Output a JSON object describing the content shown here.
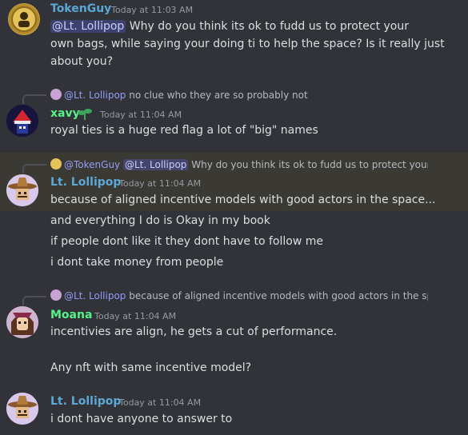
{
  "messages": [
    {
      "author": "TokenGuy",
      "timestamp": "Today at 11:03 AM",
      "mention": "@Lt. Lollipop",
      "line1": " Why do you think its ok to fudd us to protect your",
      "line2": "own bags, while saying your doing ti to help the space? Is it really just",
      "line3": "about you?"
    },
    {
      "reply_name": "@Lt. Lollipop",
      "reply_text": " no clue who they are so probably not",
      "author": "xavy",
      "timestamp": "Today at 11:04 AM",
      "line1": "royal ties is a huge red flag a lot of \"big\" names"
    },
    {
      "reply_name": "@TokenGuy",
      "reply_mention": "@Lt. Lollipop",
      "reply_text": " Why do you think its ok to fudd us to protect your",
      "author": "Lt. Lollipop",
      "timestamp": "Today at 11:04 AM",
      "line1": "because of aligned incentive models with good actors in the space...",
      "line2": "and everything I do is Okay in my book",
      "line3": "if people dont like it they dont have to follow me",
      "line4": "i dont take money from people"
    },
    {
      "reply_name": "@Lt. Lollipop",
      "reply_text": " because of aligned incentive models with good actors in the sp",
      "author": "Moana",
      "timestamp": "Today at 11:04 AM",
      "line1": "incentivies are align, he gets a cut of performance.",
      "line2": "Any nft with same incentive model?"
    },
    {
      "author": "Lt. Lollipop",
      "timestamp": "Today at 11:04 AM",
      "line1": "i dont have anyone to answer to"
    }
  ],
  "colors": {
    "background": "#313338",
    "highlight": "#3a3934",
    "tokenguy": "#5ba8d6",
    "xavy": "#57f287",
    "lollipop": "#5ba8d6",
    "moana": "#57f287",
    "mention_bg": "#3c4270"
  },
  "icons": [
    "gold-coin-avatar-icon",
    "red-hat-avatar-icon",
    "sombrero-avatar-icon",
    "girl-avatar-icon",
    "sprout-badge-icon"
  ]
}
